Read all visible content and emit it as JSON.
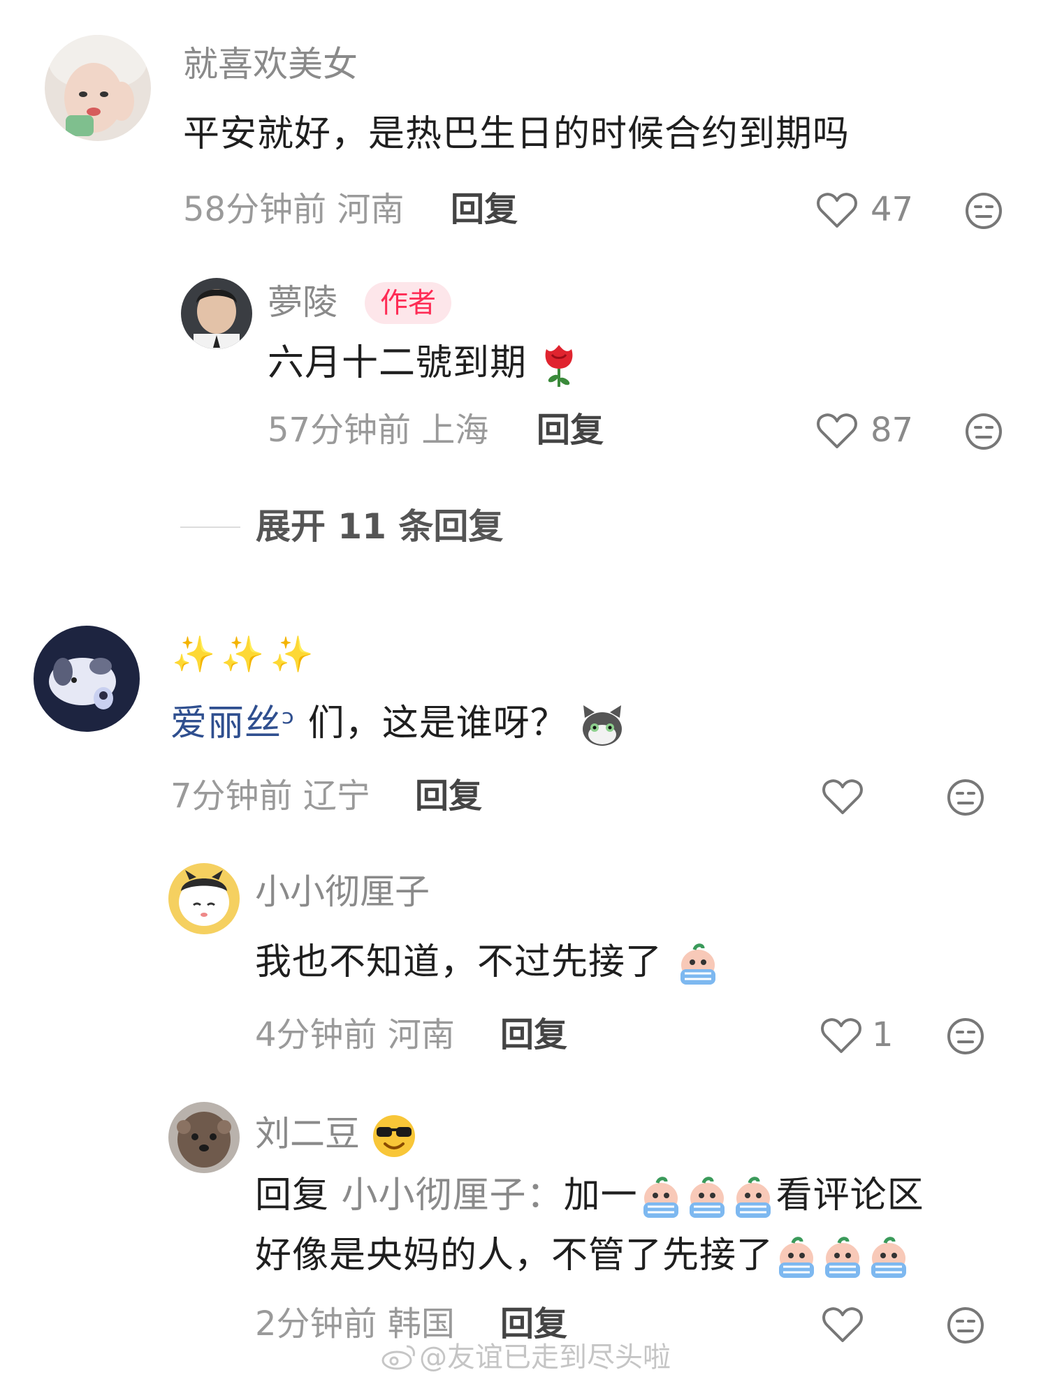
{
  "comments": [
    {
      "name": "就喜欢美女",
      "text": "平安就好，是热巴生日的时候合约到期吗",
      "time": "58分钟前",
      "location": "河南",
      "reply_label": "回复",
      "likes": "47"
    },
    {
      "name": "夢陵",
      "badge": "作者",
      "text": "六月十二號到期",
      "time": "57分钟前",
      "location": "上海",
      "reply_label": "回复",
      "likes": "87"
    },
    {
      "name": "✨✨✨",
      "mention": "爱丽丝ᵓ",
      "text": "们，这是谁呀？",
      "time": "7分钟前",
      "location": "辽宁",
      "reply_label": "回复",
      "likes": ""
    },
    {
      "name": "小小彻厘子",
      "text": "我也不知道，不过先接了",
      "time": "4分钟前",
      "location": "河南",
      "reply_label": "回复",
      "likes": "1"
    },
    {
      "name": "刘二豆",
      "reply_prefix": "回复",
      "reply_to": "小小彻厘子：",
      "text_line1": "加一",
      "text_line1b": "看评论区",
      "text_line2": "好像是央妈的人，不管了先接了",
      "time": "2分钟前",
      "location": "韩国",
      "reply_label": "回复",
      "likes": ""
    }
  ],
  "expand": {
    "label": "展开 11 条回复"
  },
  "watermark": "@友谊已走到尽头啦",
  "colors": {
    "author_badge": "#fe2c55",
    "mention": "#2f4f8f"
  }
}
